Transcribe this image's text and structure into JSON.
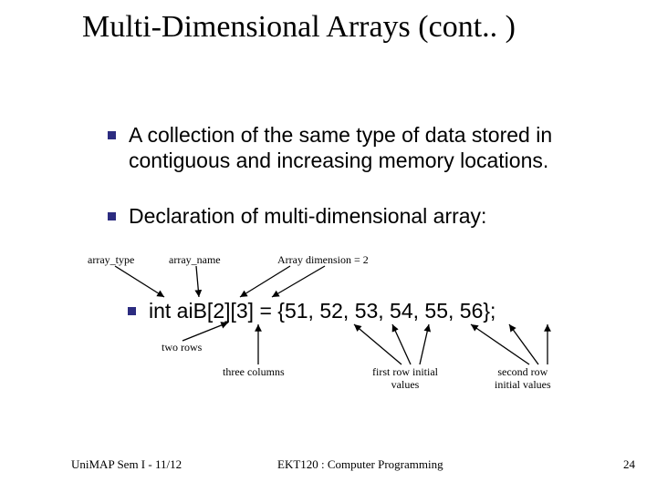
{
  "title": "Multi-Dimensional Arrays (cont.. )",
  "bullets": {
    "b1": "A collection of the same type of data stored in contiguous and increasing memory locations.",
    "b2": "Declaration of multi-dimensional array:"
  },
  "labels": {
    "array_type": "array_type",
    "array_name": "array_name",
    "array_dim": "Array dimension = 2",
    "two_rows": "two rows",
    "three_cols": "three columns",
    "first_row": "first row initial values",
    "second_row": "second row initial values"
  },
  "code": "int aiB[2][3] = {51, 52, 53, 54, 55, 56};",
  "footer": {
    "left": "UniMAP Sem I - 11/12",
    "mid": "EKT120 : Computer Programming",
    "right": "24"
  }
}
